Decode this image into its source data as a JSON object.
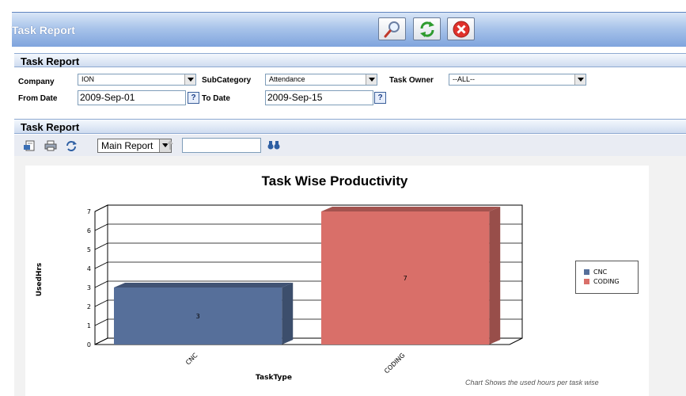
{
  "window": {
    "title": "Task Report"
  },
  "toolbar_buttons": [
    {
      "name": "search",
      "icon": "magnifier-icon"
    },
    {
      "name": "refresh",
      "icon": "refresh-icon"
    },
    {
      "name": "close",
      "icon": "close-icon"
    }
  ],
  "filters_section": {
    "title": "Task Report",
    "company_label": "Company",
    "company_value": "ION",
    "subcategory_label": "SubCategory",
    "subcategory_value": "Attendance",
    "owner_label": "Task Owner",
    "owner_value": "--ALL--",
    "from_label": "From Date",
    "from_value": "2009-Sep-01",
    "to_label": "To Date",
    "to_value": "2009-Sep-15",
    "help_glyph": "?"
  },
  "report_section": {
    "title": "Task Report",
    "report_select_value": "Main Report",
    "find_value": ""
  },
  "chart_data": {
    "type": "bar",
    "title": "Task Wise Productivity",
    "xlabel": "TaskType",
    "ylabel": "UsedHrs",
    "categories": [
      "CNC",
      "CODING"
    ],
    "values": [
      3,
      7
    ],
    "ylim": [
      0,
      7
    ],
    "yticks": [
      0,
      1,
      2,
      3,
      4,
      5,
      6,
      7
    ],
    "colors": [
      "#566f9a",
      "#d96f69"
    ],
    "legend": [
      {
        "label": "CNC",
        "color": "#566f9a"
      },
      {
        "label": "CODING",
        "color": "#d96f69"
      }
    ],
    "legend_position": "right",
    "grid": true,
    "note": "Chart Shows the used hours per task wise"
  }
}
